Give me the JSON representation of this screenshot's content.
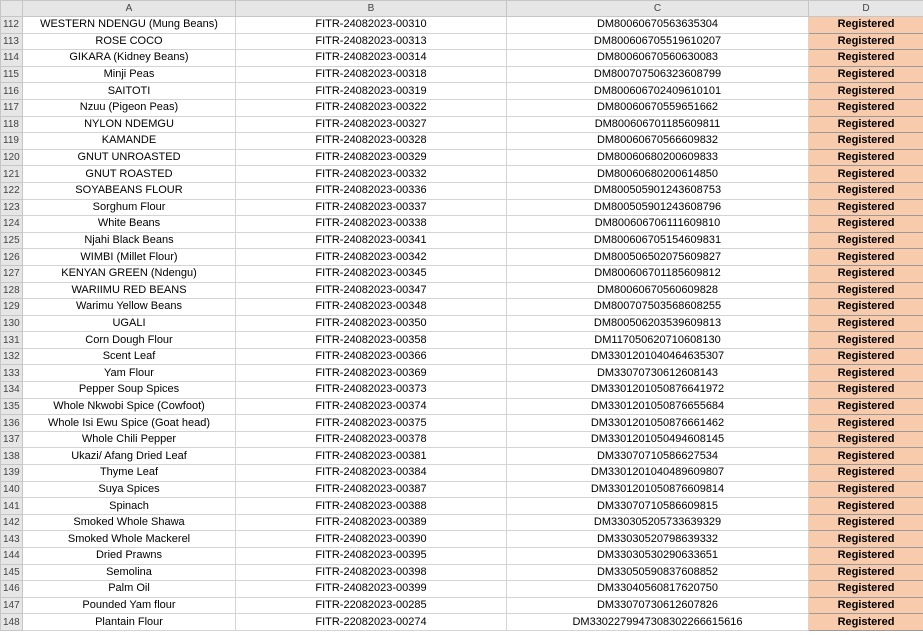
{
  "sheet": {
    "columns": [
      "A",
      "B",
      "C",
      "D"
    ],
    "status_color": "#f8cbad",
    "rows": [
      {
        "n": "112",
        "a": "WESTERN NDENGU (Mung Beans)",
        "b": "FITR-24082023-00310",
        "c": "DM80060670563635304",
        "d": "Registered"
      },
      {
        "n": "113",
        "a": "ROSE COCO",
        "b": "FITR-24082023-00313",
        "c": "DM800606705519610207",
        "d": "Registered"
      },
      {
        "n": "114",
        "a": "GIKARA (Kidney Beans)",
        "b": "FITR-24082023-00314",
        "c": "DM80060670560630083",
        "d": "Registered"
      },
      {
        "n": "115",
        "a": "Minji Peas",
        "b": "FITR-24082023-00318",
        "c": "DM800707506323608799",
        "d": "Registered"
      },
      {
        "n": "116",
        "a": "SAITOTI",
        "b": "FITR-24082023-00319",
        "c": "DM800606702409610101",
        "d": "Registered"
      },
      {
        "n": "117",
        "a": "Nzuu (Pigeon Peas)",
        "b": "FITR-24082023-00322",
        "c": "DM80060670559651662",
        "d": "Registered"
      },
      {
        "n": "118",
        "a": "NYLON NDEMGU",
        "b": "FITR-24082023-00327",
        "c": "DM800606701185609811",
        "d": "Registered"
      },
      {
        "n": "119",
        "a": "KAMANDE",
        "b": "FITR-24082023-00328",
        "c": "DM80060670566609832",
        "d": "Registered"
      },
      {
        "n": "120",
        "a": "GNUT UNROASTED",
        "b": "FITR-24082023-00329",
        "c": "DM80060680200609833",
        "d": "Registered"
      },
      {
        "n": "121",
        "a": "GNUT ROASTED",
        "b": "FITR-24082023-00332",
        "c": "DM80060680200614850",
        "d": "Registered"
      },
      {
        "n": "122",
        "a": "SOYABEANS FLOUR",
        "b": "FITR-24082023-00336",
        "c": "DM800505901243608753",
        "d": "Registered"
      },
      {
        "n": "123",
        "a": "Sorghum Flour",
        "b": "FITR-24082023-00337",
        "c": "DM800505901243608796",
        "d": "Registered"
      },
      {
        "n": "124",
        "a": "White Beans",
        "b": "FITR-24082023-00338",
        "c": "DM800606706111609810",
        "d": "Registered"
      },
      {
        "n": "125",
        "a": "Njahi Black Beans",
        "b": "FITR-24082023-00341",
        "c": "DM800606705154609831",
        "d": "Registered"
      },
      {
        "n": "126",
        "a": "WIMBI (Millet Flour)",
        "b": "FITR-24082023-00342",
        "c": "DM800506502075609827",
        "d": "Registered"
      },
      {
        "n": "127",
        "a": "KENYAN GREEN (Ndengu)",
        "b": "FITR-24082023-00345",
        "c": "DM800606701185609812",
        "d": "Registered"
      },
      {
        "n": "128",
        "a": "WARIIMU RED BEANS",
        "b": "FITR-24082023-00347",
        "c": "DM80060670560609828",
        "d": "Registered"
      },
      {
        "n": "129",
        "a": "Warimu Yellow Beans",
        "b": "FITR-24082023-00348",
        "c": "DM800707503568608255",
        "d": "Registered"
      },
      {
        "n": "130",
        "a": "UGALI",
        "b": "FITR-24082023-00350",
        "c": "DM800506203539609813",
        "d": "Registered"
      },
      {
        "n": "131",
        "a": "Corn Dough Flour",
        "b": "FITR-24082023-00358",
        "c": "DM117050620710608130",
        "d": "Registered"
      },
      {
        "n": "132",
        "a": "Scent Leaf",
        "b": "FITR-24082023-00366",
        "c": "DM3301201040464635307",
        "d": "Registered"
      },
      {
        "n": "133",
        "a": "Yam Flour",
        "b": "FITR-24082023-00369",
        "c": "DM33070730612608143",
        "d": "Registered"
      },
      {
        "n": "134",
        "a": "Pepper Soup Spices",
        "b": "FITR-24082023-00373",
        "c": "DM3301201050876641972",
        "d": "Registered"
      },
      {
        "n": "135",
        "a": "Whole Nkwobi Spice (Cowfoot)",
        "b": "FITR-24082023-00374",
        "c": "DM3301201050876655684",
        "d": "Registered"
      },
      {
        "n": "136",
        "a": "Whole Isi Ewu Spice (Goat head)",
        "b": "FITR-24082023-00375",
        "c": "DM3301201050876661462",
        "d": "Registered"
      },
      {
        "n": "137",
        "a": "Whole Chili Pepper",
        "b": "FITR-24082023-00378",
        "c": "DM3301201050494608145",
        "d": "Registered"
      },
      {
        "n": "138",
        "a": "Ukazi/ Afang Dried Leaf",
        "b": "FITR-24082023-00381",
        "c": "DM33070710586627534",
        "d": "Registered"
      },
      {
        "n": "139",
        "a": "Thyme Leaf",
        "b": "FITR-24082023-00384",
        "c": "DM3301201040489609807",
        "d": "Registered"
      },
      {
        "n": "140",
        "a": "Suya Spices",
        "b": "FITR-24082023-00387",
        "c": "DM3301201050876609814",
        "d": "Registered"
      },
      {
        "n": "141",
        "a": "Spinach",
        "b": "FITR-24082023-00388",
        "c": "DM33070710586609815",
        "d": "Registered"
      },
      {
        "n": "142",
        "a": "Smoked Whole Shawa",
        "b": "FITR-24082023-00389",
        "c": "DM330305205733639329",
        "d": "Registered"
      },
      {
        "n": "143",
        "a": "Smoked Whole Mackerel",
        "b": "FITR-24082023-00390",
        "c": "DM33030520798639332",
        "d": "Registered"
      },
      {
        "n": "144",
        "a": "Dried Prawns",
        "b": "FITR-24082023-00395",
        "c": "DM33030530290633651",
        "d": "Registered"
      },
      {
        "n": "145",
        "a": "Semolina",
        "b": "FITR-24082023-00398",
        "c": "DM33050590837608852",
        "d": "Registered"
      },
      {
        "n": "146",
        "a": "Palm Oil",
        "b": "FITR-24082023-00399",
        "c": "DM33040560817620750",
        "d": "Registered"
      },
      {
        "n": "147",
        "a": "Pounded Yam flour",
        "b": "FITR-22082023-00285",
        "c": "DM33070730612607826",
        "d": "Registered"
      },
      {
        "n": "148",
        "a": "Plantain Flour",
        "b": "FITR-22082023-00274",
        "c": "DM3302279947308302266615616",
        "d": "Registered"
      }
    ]
  }
}
